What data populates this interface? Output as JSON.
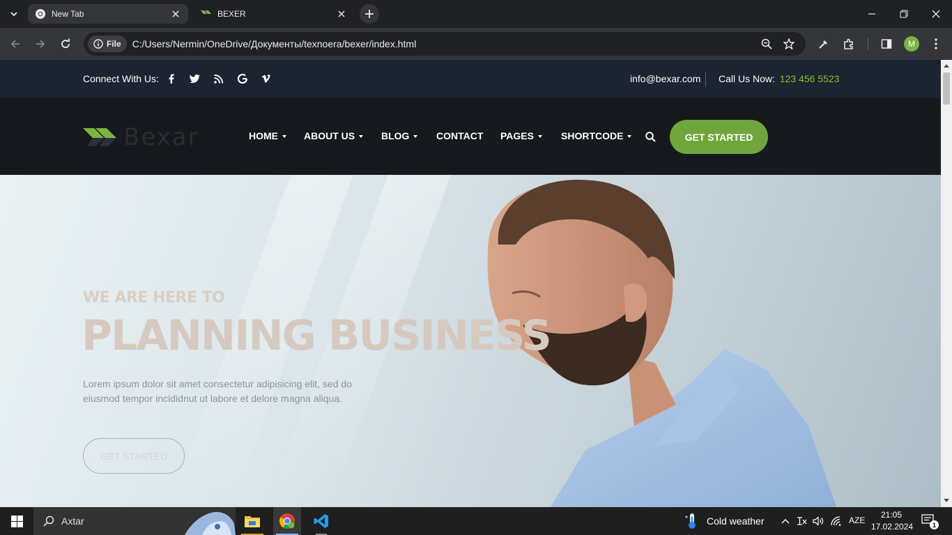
{
  "browser": {
    "tabs": [
      {
        "title": "New Tab",
        "active": true
      },
      {
        "title": "BEXER",
        "active": false
      }
    ],
    "address_chip": "File",
    "url": "C:/Users/Nermin/OneDrive/Документы/texnoera/bexer/index.html",
    "profile_initial": "M"
  },
  "topbar": {
    "connect_label": "Connect With Us:",
    "social_icons": [
      "facebook-icon",
      "twitter-icon",
      "rss-icon",
      "google-icon",
      "vimeo-icon"
    ],
    "email": "info@bexar.com",
    "call_label": "Call Us Now:",
    "phone": "123 456 5523"
  },
  "navbar": {
    "logo_text": "Bexar",
    "items": [
      {
        "label": "HOME",
        "dropdown": true
      },
      {
        "label": "ABOUT US",
        "dropdown": true
      },
      {
        "label": "BLOG",
        "dropdown": true
      },
      {
        "label": "CONTACT",
        "dropdown": false
      },
      {
        "label": "PAGES",
        "dropdown": true
      },
      {
        "label": "SHORTCODE",
        "dropdown": true
      }
    ],
    "cta_label": "GET STARTED"
  },
  "hero": {
    "eyebrow": "WE ARE HERE TO",
    "title": "PLANNING BUSINESS",
    "description": "Lorem ipsum dolor sit amet consectetur adipisicing elit, sed do eiusmod tempor incididnut ut labore et delore magna aliqua.",
    "button_label": "GET STARTED"
  },
  "taskbar": {
    "search_placeholder": "Axtar",
    "weather": "Cold weather",
    "language": "AZE",
    "time": "21:05",
    "date": "17.02.2024",
    "notification_count": "1"
  },
  "colors": {
    "accent_green": "#6fa63b",
    "phone_green": "#86c232",
    "topbar_bg": "#1c2331",
    "navbar_bg": "#16191d"
  }
}
